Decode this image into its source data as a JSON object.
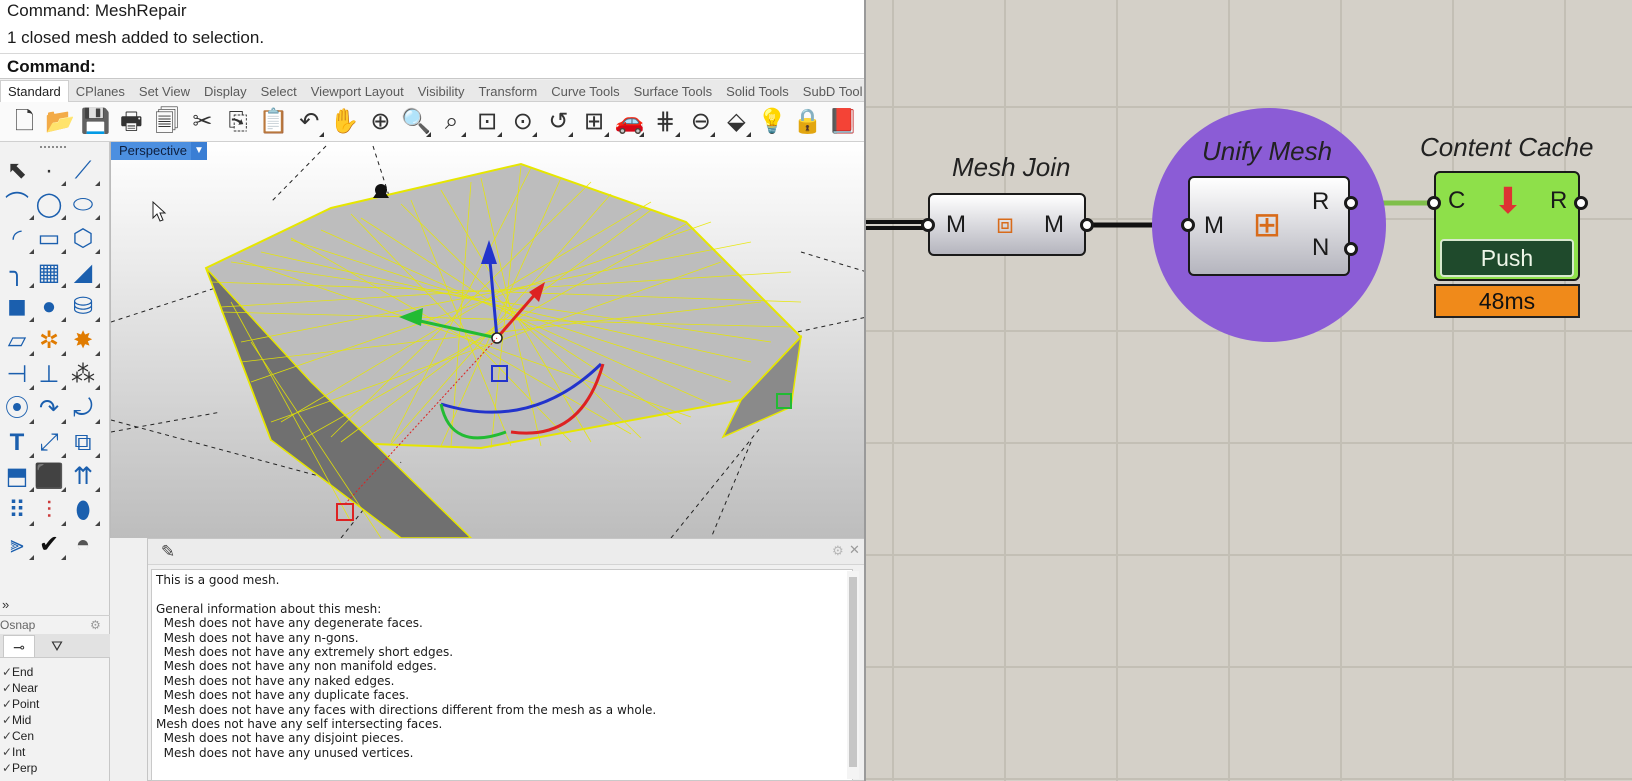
{
  "command_history": [
    "Command: MeshRepair",
    "1 closed mesh added to selection."
  ],
  "command_prompt": "Command:",
  "tabs": [
    "Standard",
    "CPlanes",
    "Set View",
    "Display",
    "Select",
    "Viewport Layout",
    "Visibility",
    "Transform",
    "Curve Tools",
    "Surface Tools",
    "Solid Tools",
    "SubD Tool"
  ],
  "toolbar_icons": [
    {
      "name": "new-icon",
      "glyph": "🗋"
    },
    {
      "name": "open-icon",
      "glyph": "📂"
    },
    {
      "name": "save-icon",
      "glyph": "💾"
    },
    {
      "name": "print-icon",
      "glyph": "🖶"
    },
    {
      "name": "import-icon",
      "glyph": "🗐"
    },
    {
      "name": "cut-icon",
      "glyph": "✂"
    },
    {
      "name": "copy-icon",
      "glyph": "⎘"
    },
    {
      "name": "paste-icon",
      "glyph": "📋"
    },
    {
      "name": "undo-icon",
      "glyph": "↶"
    },
    {
      "name": "pan-icon",
      "glyph": "✋"
    },
    {
      "name": "rotate-view-icon",
      "glyph": "⊕"
    },
    {
      "name": "zoom-icon",
      "glyph": "🔍"
    },
    {
      "name": "zoom-window-icon",
      "glyph": "⌕"
    },
    {
      "name": "zoom-extents-icon",
      "glyph": "⊡"
    },
    {
      "name": "zoom-selected-icon",
      "glyph": "⊙"
    },
    {
      "name": "undo-view-icon",
      "glyph": "↺"
    },
    {
      "name": "four-viewports-icon",
      "glyph": "⊞"
    },
    {
      "name": "car-icon",
      "glyph": "🚗"
    },
    {
      "name": "grid-icon",
      "glyph": "⋕"
    },
    {
      "name": "osnap-icon",
      "glyph": "⊖"
    },
    {
      "name": "properties-icon",
      "glyph": "⬙"
    },
    {
      "name": "light-icon",
      "glyph": "💡"
    },
    {
      "name": "lock-icon",
      "glyph": "🔒"
    },
    {
      "name": "book-icon",
      "glyph": "📕"
    }
  ],
  "viewport": {
    "label": "Perspective"
  },
  "osnap": {
    "header": "Osnap",
    "items": [
      {
        "label": "End",
        "checked": "✓"
      },
      {
        "label": "Near",
        "checked": "✓"
      },
      {
        "label": "Point",
        "checked": "✓"
      },
      {
        "label": "Mid",
        "checked": "✓"
      },
      {
        "label": "Cen",
        "checked": "✓"
      },
      {
        "label": "Int",
        "checked": "✓"
      },
      {
        "label": "Perp",
        "checked": "✓"
      }
    ]
  },
  "side_expand": "»",
  "check_panel": {
    "lines": [
      "This is a good mesh.",
      "",
      "General information about this mesh:",
      "  Mesh does not have any degenerate faces.",
      "  Mesh does not have any n-gons.",
      "  Mesh does not have any extremely short edges.",
      "  Mesh does not have any non manifold edges.",
      "  Mesh does not have any naked edges.",
      "  Mesh does not have any duplicate faces.",
      "  Mesh does not have any faces with directions different from the mesh as a whole.",
      "Mesh does not have any self intersecting faces.",
      "  Mesh does not have any disjoint pieces.",
      "  Mesh does not have any unused vertices."
    ]
  },
  "grasshopper": {
    "mesh_join": {
      "title": "Mesh Join",
      "input": "M",
      "output": "M"
    },
    "unify_mesh": {
      "title": "Unify Mesh",
      "input": "M",
      "output_r": "R",
      "output_n": "N",
      "highlight": "#8b5cd6"
    },
    "content_cache": {
      "title": "Content Cache",
      "input": "C",
      "output": "R",
      "button": "Push",
      "timing": "48ms",
      "accent": "#8ee04a",
      "timing_color": "#f08a1a"
    }
  }
}
